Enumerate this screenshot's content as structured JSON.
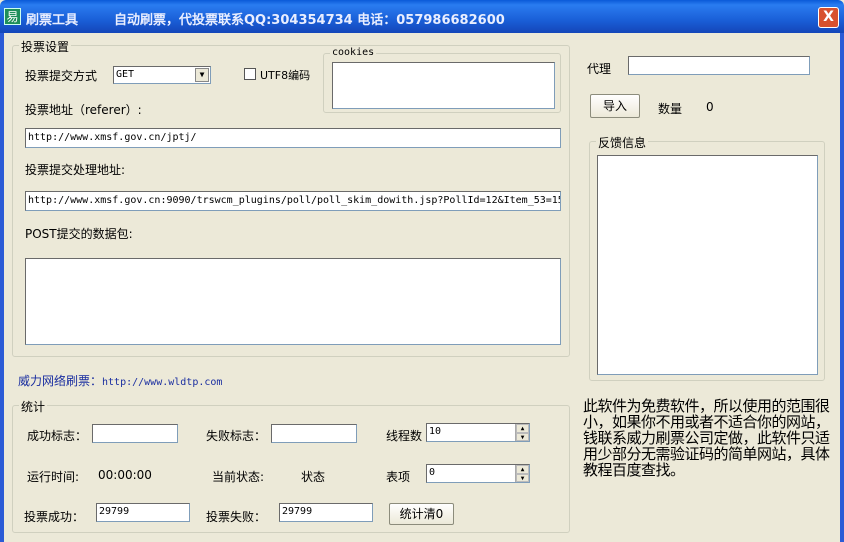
{
  "window": {
    "app_name": "刷票工具",
    "title_info": "自动刷票，代投票联系QQ:304354734   电话：057986682600",
    "icon_glyph": "易",
    "close_glyph": "X"
  },
  "vote_settings": {
    "group_label": "投票设置",
    "method_label": "投票提交方式",
    "method_value": "GET",
    "utf8_label": "UTF8编码",
    "cookies_label": "cookies",
    "cookies_value": "",
    "referer_label": "投票地址（referer）:",
    "referer_value": "http://www.xmsf.gov.cn/jptj/",
    "handler_label": "投票提交处理地址:",
    "handler_value": "http://www.xmsf.gov.cn:9090/trswcm_plugins/poll/poll_skim_dowith.jsp?PollId=12&Item_53=15",
    "post_label": "POST提交的数据包:",
    "post_value": ""
  },
  "link": {
    "label": "威力网络刷票：",
    "url": "http://www.wldtp.com"
  },
  "stats": {
    "group_label": "统计",
    "success_flag_label": "成功标志：",
    "fail_flag_label": "失败标志：",
    "threads_label": "线程数",
    "threads_value": "10",
    "runtime_label": "运行时间:",
    "runtime_value": "00:00:00",
    "status_label": "当前状态:",
    "status_value": "状态",
    "item_label": "表项",
    "item_value": "0",
    "vote_success_label": "投票成功：",
    "vote_success_value": "29799",
    "vote_fail_label": "投票失败：",
    "vote_fail_value": "29799",
    "clear_button": "统计清0"
  },
  "proxy": {
    "label": "代理",
    "value": "",
    "import_button": "导入",
    "count_label": "数量",
    "count_value": "0"
  },
  "feedback": {
    "group_label": "反馈信息"
  },
  "notice": "此软件为免费软件，所以使用的范围很小，如果你不用或者不适合你的网站，钱联系威力刷票公司定做，此软件只适用少部分无需验证码的简单网站，具体教程百度查找。"
}
